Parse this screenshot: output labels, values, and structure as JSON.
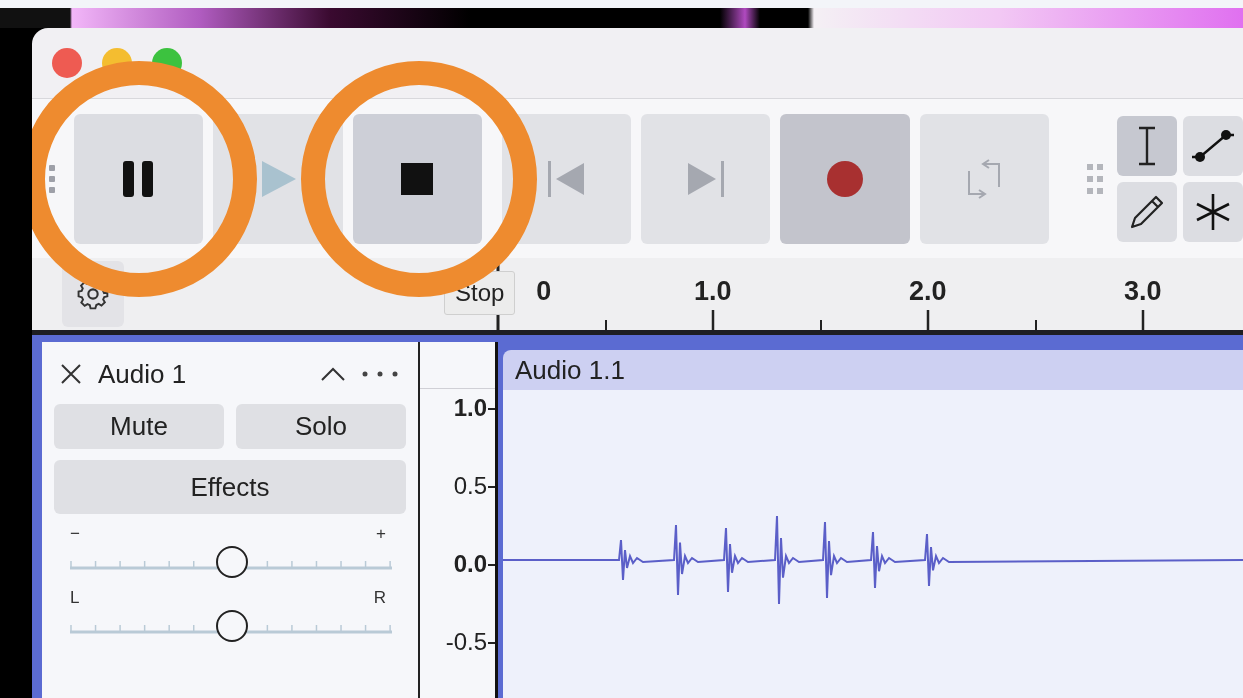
{
  "transport": [
    {
      "kind": "pause",
      "disabled": false,
      "highlighted": false,
      "circled": true
    },
    {
      "kind": "play",
      "disabled": true,
      "highlighted": false,
      "circled": false
    },
    {
      "kind": "stop",
      "disabled": false,
      "highlighted": true,
      "circled": true,
      "tooltip": "Stop"
    },
    {
      "kind": "skip_start",
      "disabled": true,
      "highlighted": false,
      "circled": false
    },
    {
      "kind": "skip_end",
      "disabled": true,
      "highlighted": false,
      "circled": false
    },
    {
      "kind": "record",
      "disabled": false,
      "highlighted": true,
      "circled": false
    },
    {
      "kind": "loop",
      "disabled": true,
      "highlighted": false,
      "circled": false
    }
  ],
  "tools": [
    {
      "kind": "select",
      "selected": true
    },
    {
      "kind": "envelope",
      "selected": false
    },
    {
      "kind": "draw",
      "selected": false
    },
    {
      "kind": "multi",
      "selected": false
    }
  ],
  "ruler": {
    "labels": [
      "0",
      "1.0",
      "2.0",
      "3.0"
    ]
  },
  "track": {
    "name": "Audio 1",
    "buttons": [
      "Mute",
      "Solo"
    ],
    "effects": "Effects",
    "gain": {
      "min_label": "−",
      "max_label": "+",
      "level": 0.5
    },
    "pan": {
      "min_label": "L",
      "max_label": "R",
      "level": 0.5
    }
  },
  "scale": {
    "labels": [
      "1.0",
      "0.5",
      "0.0",
      "-0.5"
    ]
  },
  "clip": {
    "name": "Audio 1.1"
  }
}
